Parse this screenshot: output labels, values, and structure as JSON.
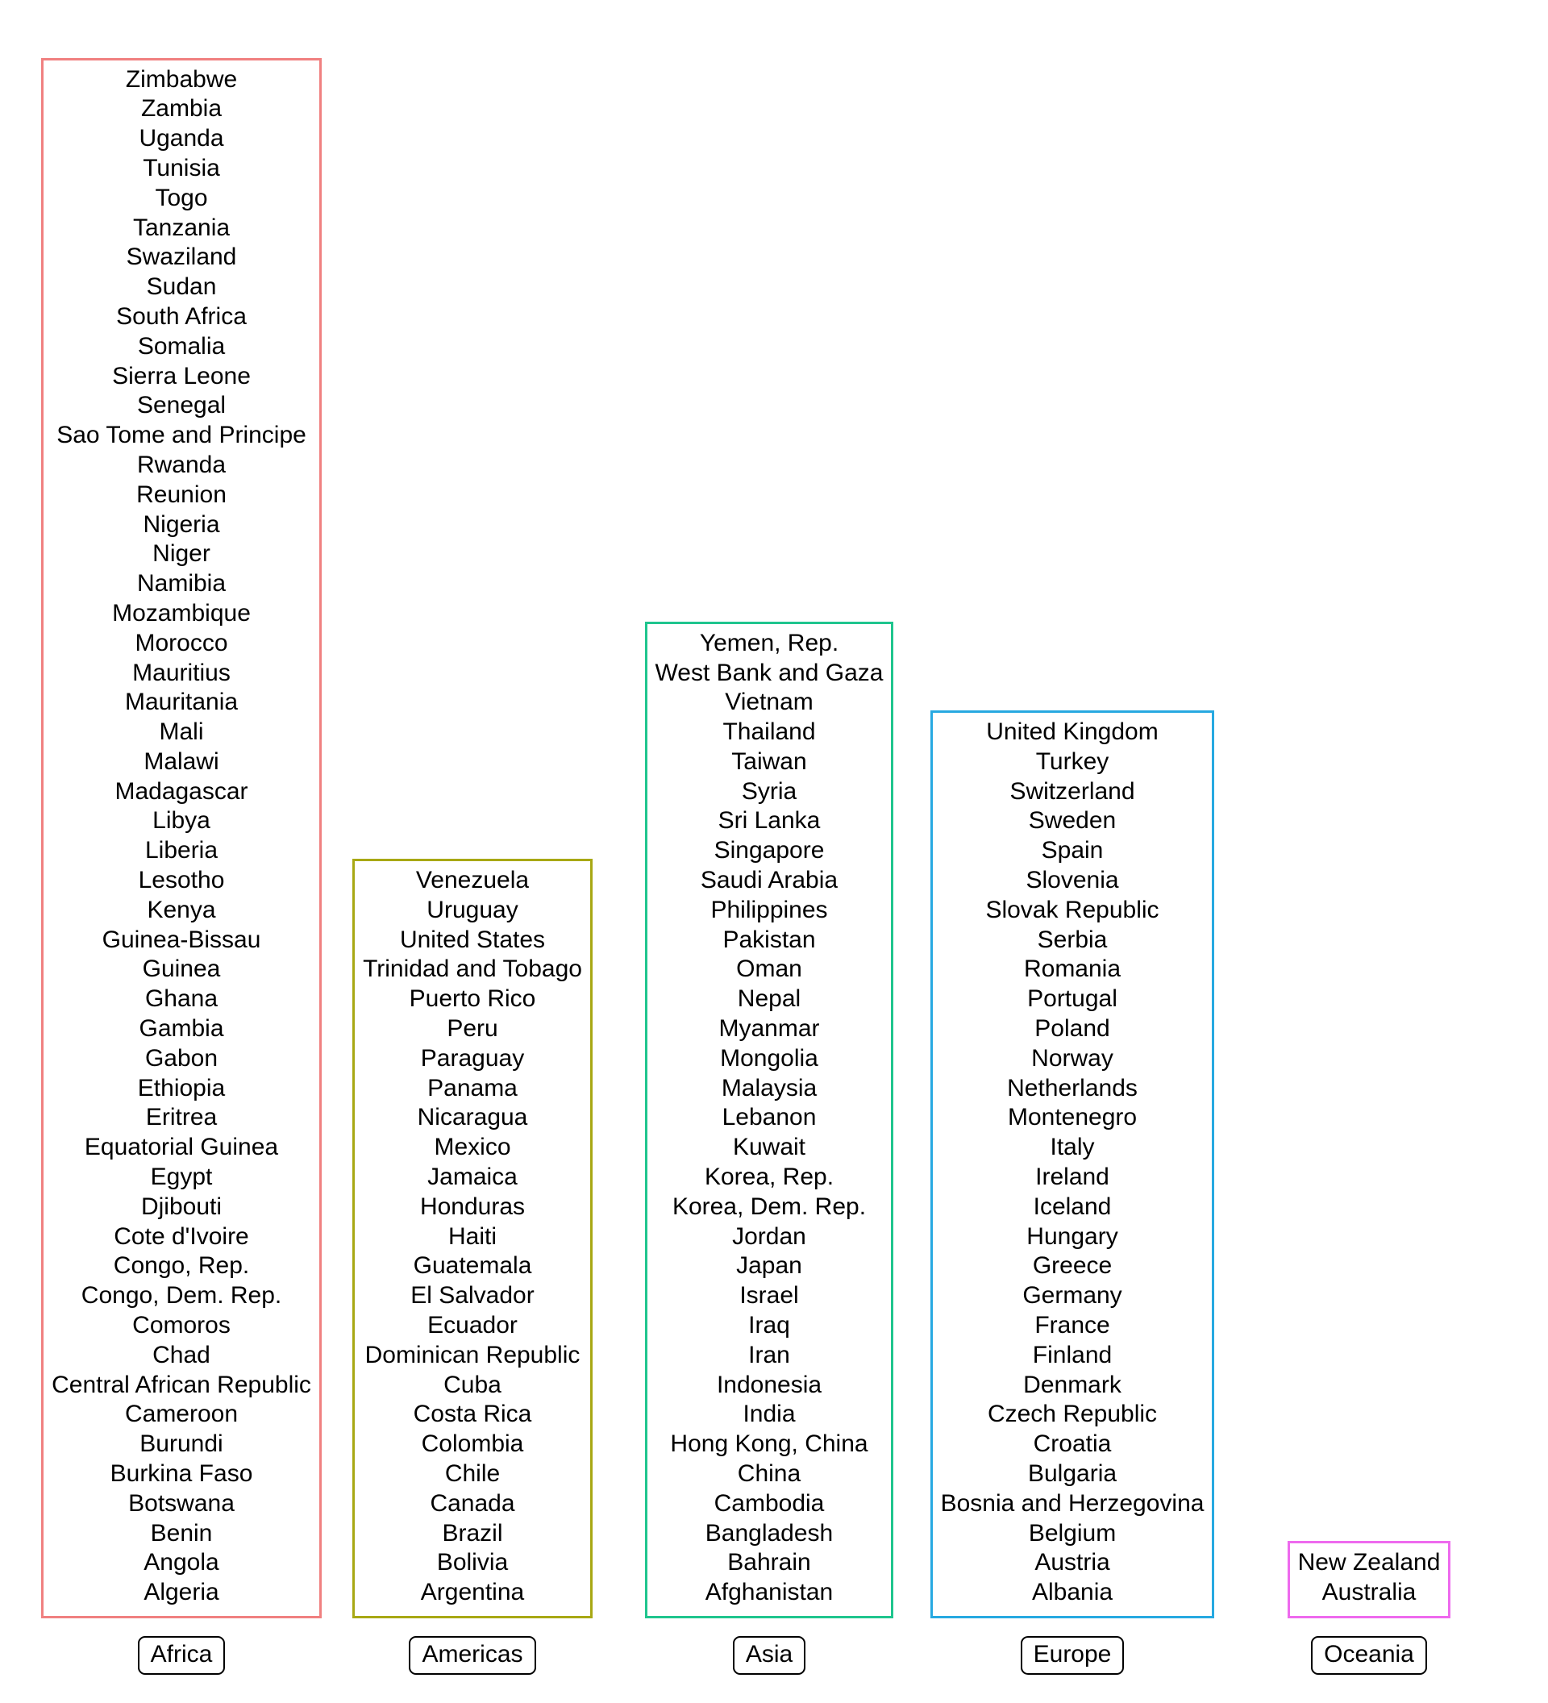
{
  "figure": {
    "kind": "grouped-country-listing",
    "background_color": "#ffffff",
    "text_color": "#000000",
    "label_border_color": "#000000"
  },
  "groups": [
    {
      "id": "africa",
      "label": "Africa",
      "border_color": "#f08080",
      "count": 49,
      "countries": [
        "Zimbabwe",
        "Zambia",
        "Uganda",
        "Tunisia",
        "Togo",
        "Tanzania",
        "Swaziland",
        "Sudan",
        "South Africa",
        "Somalia",
        "Sierra Leone",
        "Senegal",
        "Sao Tome and Principe",
        "Rwanda",
        "Reunion",
        "Nigeria",
        "Niger",
        "Namibia",
        "Mozambique",
        "Morocco",
        "Mauritius",
        "Mauritania",
        "Mali",
        "Malawi",
        "Madagascar",
        "Libya",
        "Liberia",
        "Lesotho",
        "Kenya",
        "Guinea-Bissau",
        "Guinea",
        "Ghana",
        "Gambia",
        "Gabon",
        "Ethiopia",
        "Eritrea",
        "Equatorial Guinea",
        "Egypt",
        "Djibouti",
        "Cote d'Ivoire",
        "Congo, Rep.",
        "Congo, Dem. Rep.",
        "Comoros",
        "Chad",
        "Central African Republic",
        "Cameroon",
        "Burundi",
        "Burkina Faso",
        "Botswana",
        "Benin",
        "Angola",
        "Algeria"
      ]
    },
    {
      "id": "americas",
      "label": "Americas",
      "border_color": "#a8a814",
      "count": 25,
      "countries": [
        "Venezuela",
        "Uruguay",
        "United States",
        "Trinidad and Tobago",
        "Puerto Rico",
        "Peru",
        "Paraguay",
        "Panama",
        "Nicaragua",
        "Mexico",
        "Jamaica",
        "Honduras",
        "Haiti",
        "Guatemala",
        "El Salvador",
        "Ecuador",
        "Dominican Republic",
        "Cuba",
        "Costa Rica",
        "Colombia",
        "Chile",
        "Canada",
        "Brazil",
        "Bolivia",
        "Argentina"
      ]
    },
    {
      "id": "asia",
      "label": "Asia",
      "border_color": "#1fc58e",
      "count": 33,
      "countries": [
        "Yemen, Rep.",
        "West Bank and Gaza",
        "Vietnam",
        "Thailand",
        "Taiwan",
        "Syria",
        "Sri Lanka",
        "Singapore",
        "Saudi Arabia",
        "Philippines",
        "Pakistan",
        "Oman",
        "Nepal",
        "Myanmar",
        "Mongolia",
        "Malaysia",
        "Lebanon",
        "Kuwait",
        "Korea, Rep.",
        "Korea, Dem. Rep.",
        "Jordan",
        "Japan",
        "Israel",
        "Iraq",
        "Iran",
        "Indonesia",
        "India",
        "Hong Kong, China",
        "China",
        "Cambodia",
        "Bangladesh",
        "Bahrain",
        "Afghanistan"
      ]
    },
    {
      "id": "europe",
      "label": "Europe",
      "border_color": "#27a9e1",
      "count": 31,
      "countries": [
        "United Kingdom",
        "Turkey",
        "Switzerland",
        "Sweden",
        "Spain",
        "Slovenia",
        "Slovak Republic",
        "Serbia",
        "Romania",
        "Portugal",
        "Poland",
        "Norway",
        "Netherlands",
        "Montenegro",
        "Italy",
        "Ireland",
        "Iceland",
        "Hungary",
        "Greece",
        "Germany",
        "France",
        "Finland",
        "Denmark",
        "Czech Republic",
        "Croatia",
        "Bulgaria",
        "Bosnia and Herzegovina",
        "Belgium",
        "Austria",
        "Albania"
      ]
    },
    {
      "id": "oceania",
      "label": "Oceania",
      "border_color": "#ee6aee",
      "count": 2,
      "countries": [
        "New Zealand",
        "Australia"
      ]
    }
  ]
}
